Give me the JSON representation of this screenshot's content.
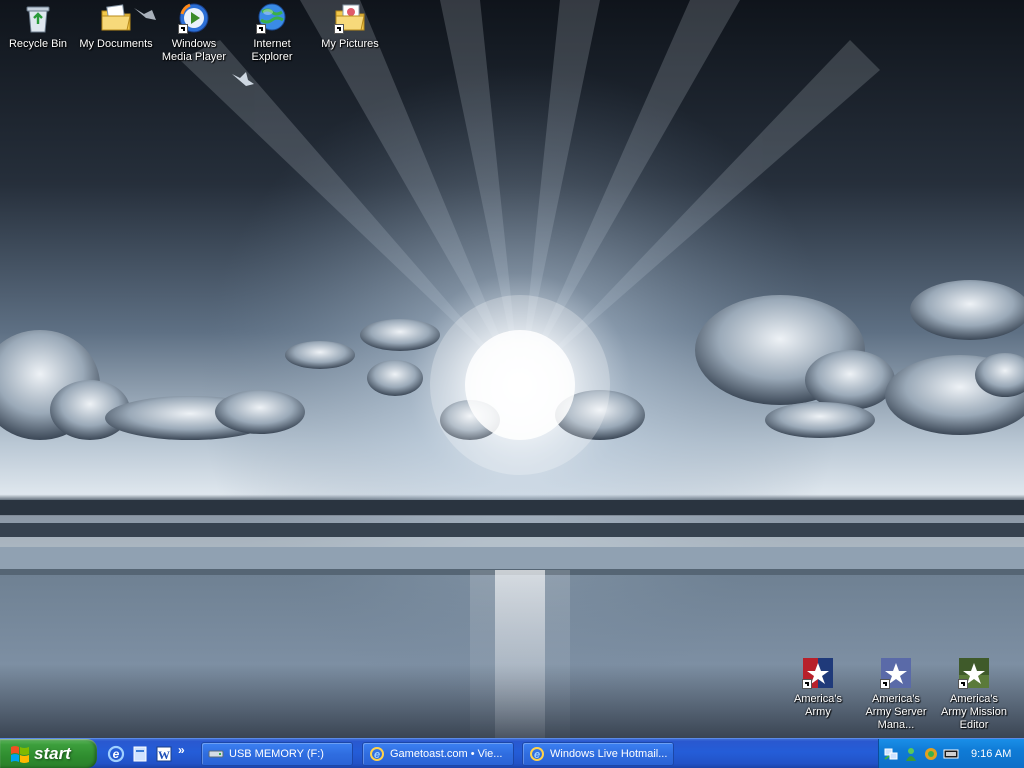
{
  "desktop": {
    "icons_top": [
      {
        "label": "Recycle Bin",
        "icon": "recycle-bin-icon",
        "shortcut": false
      },
      {
        "label": "My Documents",
        "icon": "my-documents-icon",
        "shortcut": false
      },
      {
        "label": "Windows Media Player",
        "icon": "windows-media-player-icon",
        "shortcut": true
      },
      {
        "label": "Internet Explorer",
        "icon": "internet-explorer-icon",
        "shortcut": true
      },
      {
        "label": "My Pictures",
        "icon": "my-pictures-icon",
        "shortcut": true
      }
    ],
    "icons_bottom": [
      {
        "label": "America's Army",
        "icon": "americas-army-icon",
        "shortcut": true
      },
      {
        "label": "America's Army Server Mana...",
        "icon": "americas-army-server-icon",
        "shortcut": true
      },
      {
        "label": "America's Army Mission Editor",
        "icon": "americas-army-editor-icon",
        "shortcut": true
      }
    ],
    "wallpaper": "beach-sunburst-clouds"
  },
  "taskbar": {
    "start_label": "start",
    "quick_launch": [
      "internet-explorer-icon",
      "show-desktop-icon",
      "word-icon"
    ],
    "quick_launch_more": "»",
    "tasks": [
      {
        "label": "USB MEMORY (F:)",
        "icon": "drive-icon"
      },
      {
        "label": "Gametoast.com • Vie...",
        "icon": "internet-explorer-icon"
      },
      {
        "label": "Windows Live Hotmail...",
        "icon": "internet-explorer-icon"
      }
    ],
    "tray": {
      "icons": [
        "network-icon",
        "messenger-icon",
        "security-icon",
        "volume-icon"
      ],
      "clock": "9:16 AM"
    }
  },
  "colors": {
    "taskbar_blue": "#245dd8",
    "start_green": "#3c9e3c",
    "tray_blue": "#0f7bd6"
  }
}
